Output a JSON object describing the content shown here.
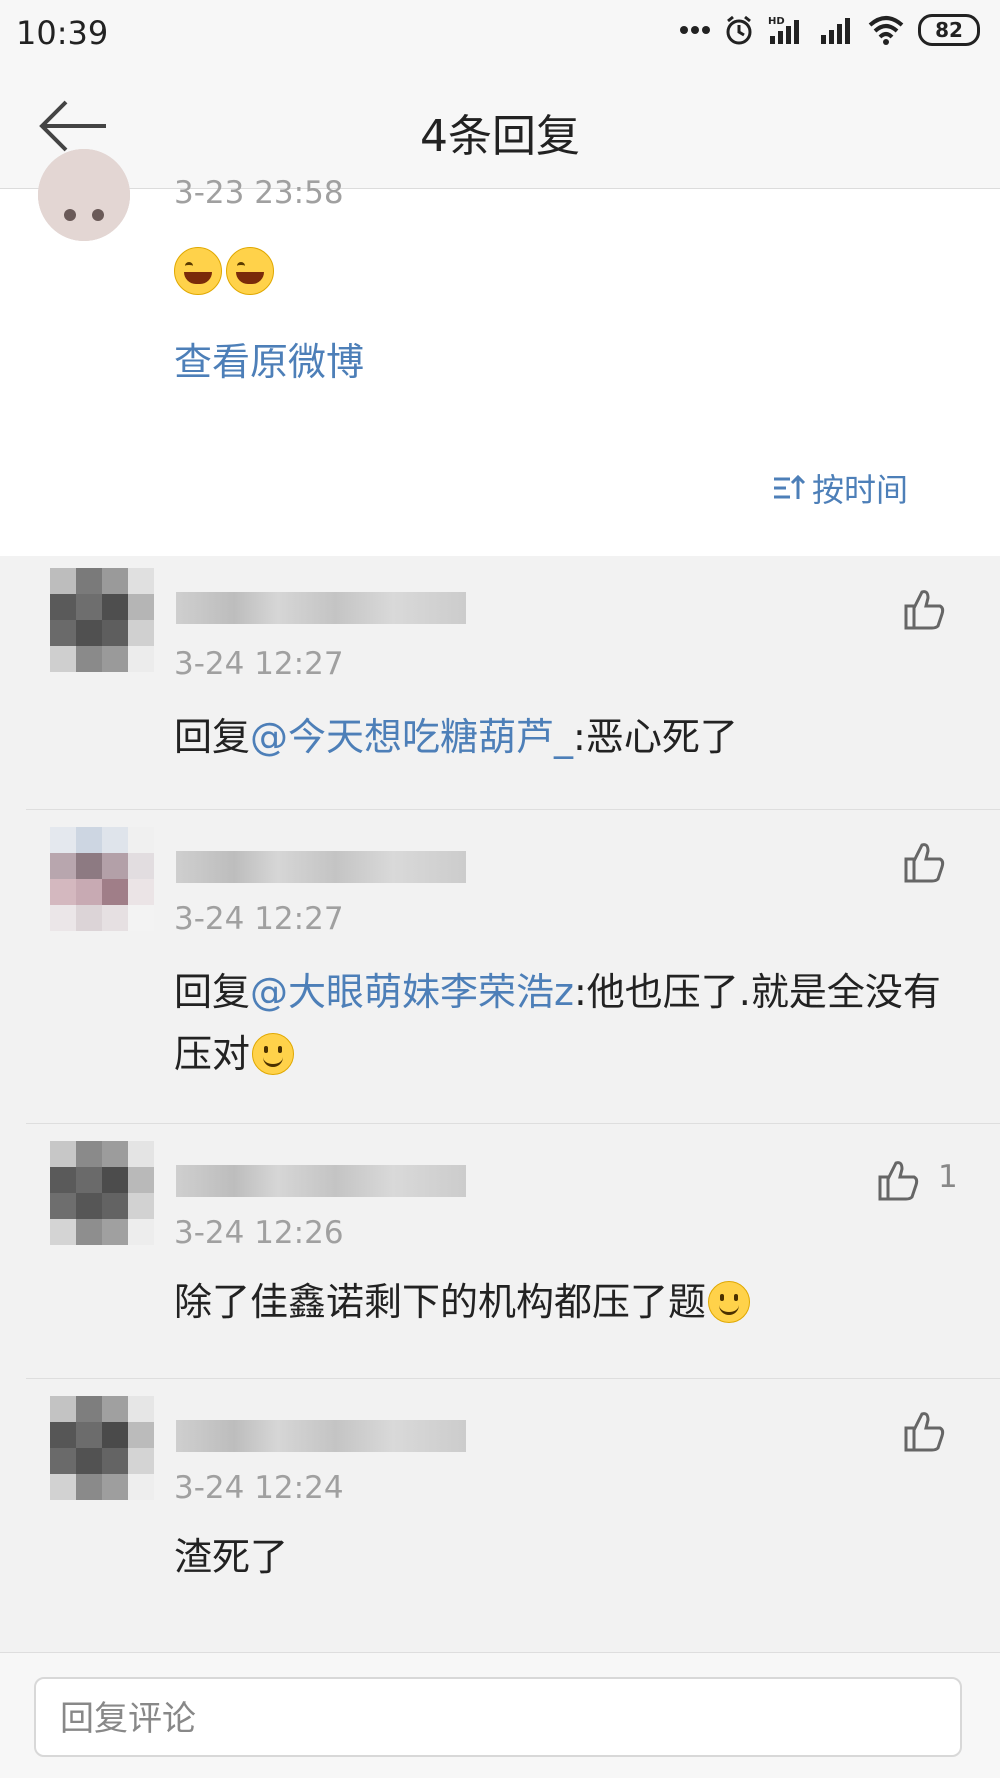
{
  "status_bar": {
    "time": "10:39",
    "battery": "82",
    "hd_label": "HD"
  },
  "header": {
    "title": "4条回复"
  },
  "top_post": {
    "time": "3-23 23:58",
    "view_original": "查看原微博",
    "sort_label": "按时间"
  },
  "comments": [
    {
      "time": "3-24 12:27",
      "prefix": "回复",
      "mention": "@今天想吃糖葫芦_",
      "text": ":恶心死了",
      "likes": ""
    },
    {
      "time": "3-24 12:27",
      "prefix": "回复",
      "mention": "@大眼萌妹李荣浩z",
      "text": ":他也压了.就是全没有压对",
      "likes": ""
    },
    {
      "time": "3-24 12:26",
      "prefix": "",
      "mention": "",
      "text": "除了佳鑫诺剩下的机构都压了题",
      "likes": "1"
    },
    {
      "time": "3-24 12:24",
      "prefix": "",
      "mention": "",
      "text": "渣死了",
      "likes": ""
    }
  ],
  "footer": {
    "reply_placeholder": "回复评论"
  },
  "colors": {
    "link": "#4d7fb8",
    "background": "#f2f2f2",
    "card": "#ffffff",
    "time_text": "#a0a0a0"
  }
}
